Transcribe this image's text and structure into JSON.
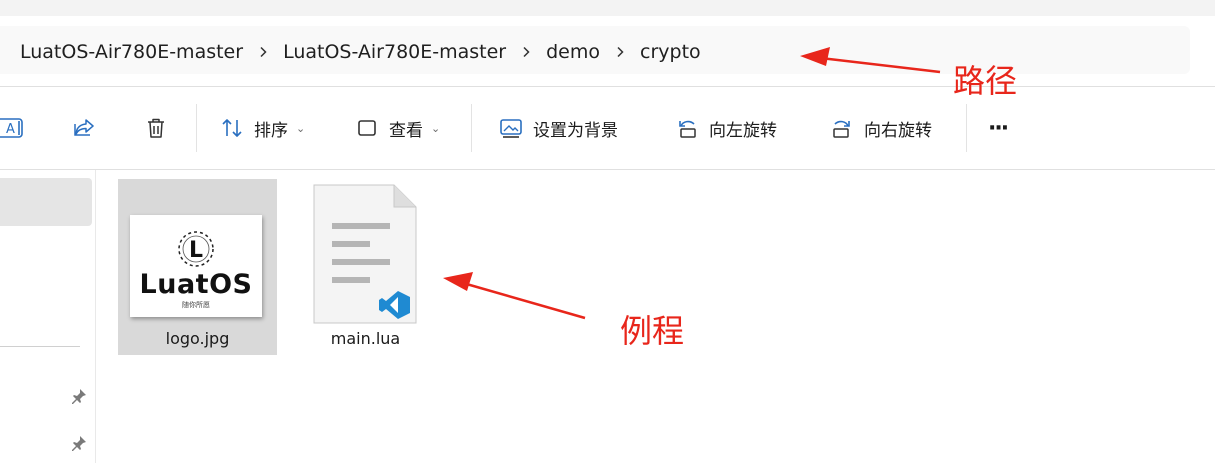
{
  "breadcrumb": {
    "items": [
      "LuatOS-Air780E-master",
      "LuatOS-Air780E-master",
      "demo",
      "crypto"
    ]
  },
  "toolbar": {
    "sort_label": "排序",
    "view_label": "查看",
    "set_background_label": "设置为背景",
    "rotate_left_label": "向左旋转",
    "rotate_right_label": "向右旋转",
    "more_label": "···"
  },
  "files": [
    {
      "name": "logo.jpg",
      "thumbnail_text": "LuatOS",
      "thumbnail_subtext": "随你所愿"
    },
    {
      "name": "main.lua"
    }
  ],
  "annotations": {
    "path_label": "路径",
    "example_label": "例程",
    "color": "#e8261b"
  },
  "icons": [
    "rename-icon",
    "share-icon",
    "delete-icon",
    "sort-icon",
    "view-icon",
    "set-background-icon",
    "rotate-left-icon",
    "rotate-right-icon",
    "more-icon",
    "pin-icon",
    "vscode-icon"
  ]
}
